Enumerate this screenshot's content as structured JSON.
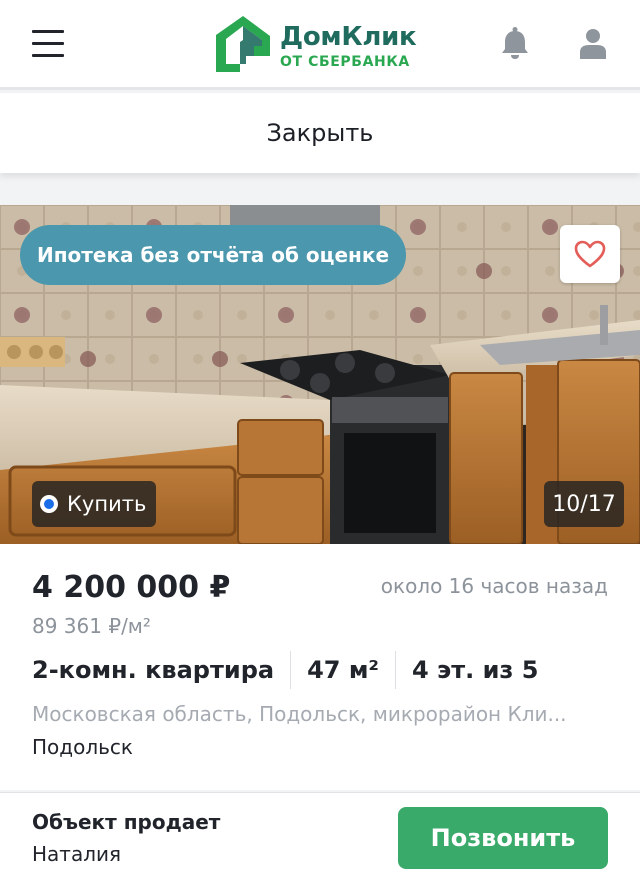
{
  "header": {
    "logo_name": "ДомКлик",
    "logo_sub": "ОТ СБЕРБАНКА",
    "menu_icon": "hamburger-menu-icon",
    "notification_icon": "bell-icon",
    "profile_icon": "user-icon",
    "brand_color": "#2aa851"
  },
  "close_label": "Закрыть",
  "gallery": {
    "mortgage_badge": "Ипотека без отчёта об оценке",
    "deal_type": "Купить",
    "counter": "10/17",
    "favorite_icon": "heart-icon",
    "badge_color": "#4b97ad"
  },
  "listing": {
    "price": "4 200 000 ₽",
    "posted": "около 16 часов назад",
    "price_per_m2": "89 361 ₽/м²",
    "rooms": "2-комн. квартира",
    "area": "47 м²",
    "floor": "4 эт. из 5",
    "address": "Московская область, Подольск, микрорайон Кли...",
    "city": "Подольск"
  },
  "seller": {
    "label": "Объект продает",
    "name": "Наталия",
    "call_label": "Позвонить",
    "call_color": "#3aaa6b"
  }
}
